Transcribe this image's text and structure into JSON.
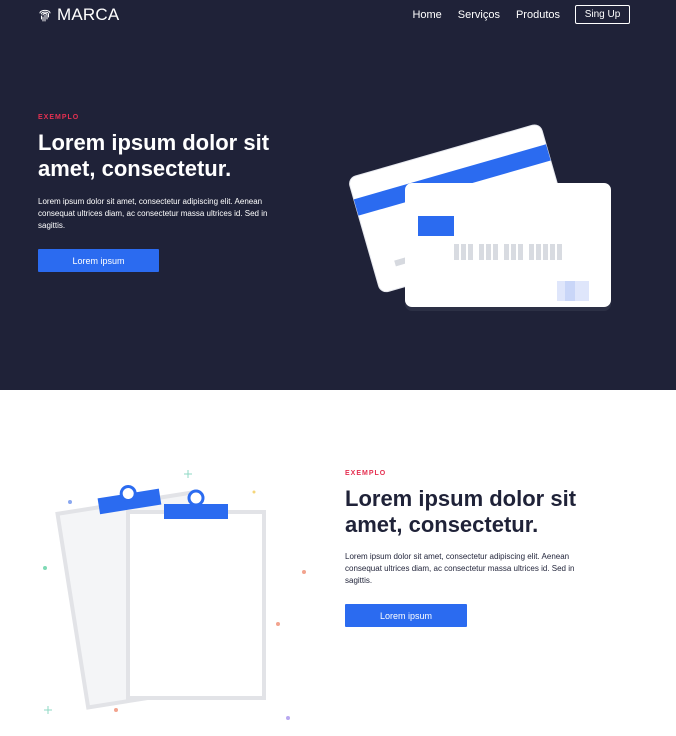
{
  "nav": {
    "brand": "MARCA",
    "links": [
      "Home",
      "Serviços",
      "Produtos"
    ],
    "cta": "Sing Up"
  },
  "hero": {
    "eyebrow": "EXEMPLO",
    "title": "Lorem ipsum dolor sit amet, consectetur.",
    "description": "Lorem ipsum dolor sit amet, consectetur adipiscing elit. Aenean consequat ultrices diam, ac consectetur massa ultrices id. Sed in sagittis.",
    "button": "Lorem ipsum",
    "illustration": "credit-cards"
  },
  "feature": {
    "eyebrow": "EXEMPLO",
    "title": "Lorem ipsum dolor sit amet, consectetur.",
    "description": "Lorem ipsum dolor sit amet, consectetur adipiscing elit. Aenean consequat ultrices diam, ac consectetur massa ultrices id. Sed in sagittis.",
    "button": "Lorem ipsum",
    "illustration": "clipboards"
  },
  "colors": {
    "dark_background": "#1f2238",
    "accent_blue": "#2b6bf0",
    "eyebrow_red": "#e53051",
    "white": "#ffffff"
  }
}
